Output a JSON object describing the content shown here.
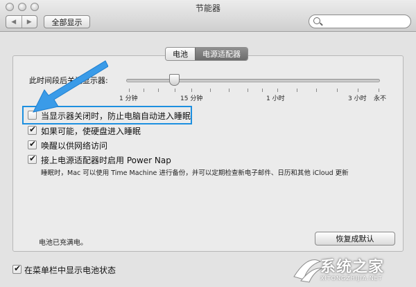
{
  "window": {
    "title": "节能器",
    "nav_back_icon": "◀",
    "nav_forward_icon": "▶",
    "show_all_label": "全部显示",
    "search_placeholder": ""
  },
  "tabs": [
    {
      "label": "电池",
      "active": false
    },
    {
      "label": "电源适配器",
      "active": true
    }
  ],
  "sleep_slider": {
    "label": "此时间段后关闭显示器:",
    "value_label": "15 分钟",
    "ticks": [
      "1 分钟",
      "15 分钟",
      "1 小时",
      "3 小时",
      "永不"
    ]
  },
  "options": [
    {
      "label": "当显示器关闭时，防止电脑自动进入睡眠",
      "checked": false
    },
    {
      "label": "如果可能，使硬盘进入睡眠",
      "checked": true
    },
    {
      "label": "唤醒以供网络访问",
      "checked": true
    },
    {
      "label": "接上电源适配器时启用 Power Nap",
      "checked": true
    }
  ],
  "power_nap_desc": "睡眠时，Mac 可以使用 Time Machine 进行备份，并可以定期检查新电子邮件、日历和其他 iCloud 更新",
  "battery_status": "电池已充满电。",
  "restore_defaults_label": "恢复成默认",
  "menubar_option": {
    "label": "在菜单栏中显示电池状态",
    "checked": true
  },
  "watermark": {
    "text": "系统之家",
    "sub": "XITONGZHIJIA.NET"
  },
  "colors": {
    "highlight": "#1c8fe0",
    "arrow": "#3a9be8"
  }
}
